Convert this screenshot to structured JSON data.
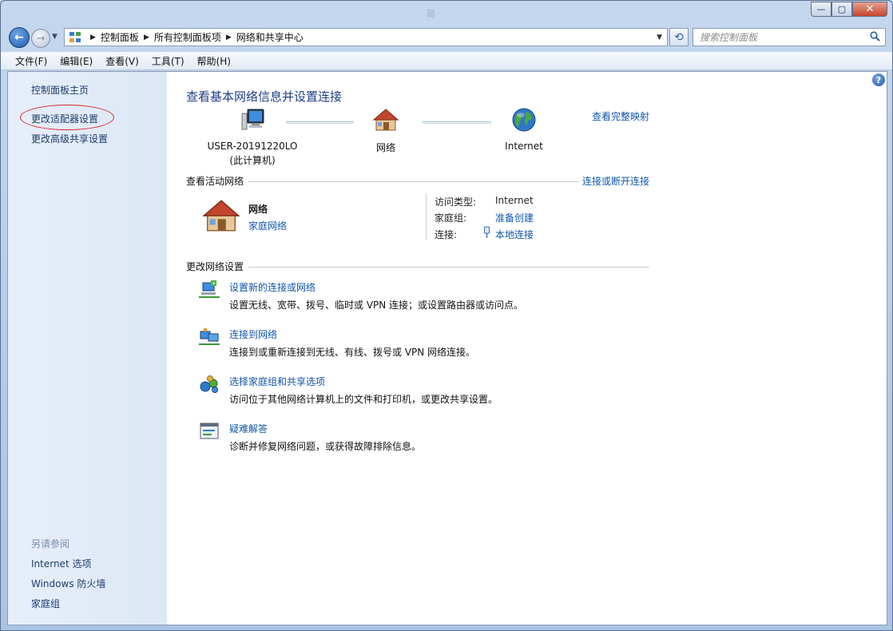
{
  "window": {
    "ghost_titles": [
      "局"
    ],
    "minimize_glyph": "—",
    "maximize_glyph": "▢",
    "close_glyph": "✕"
  },
  "nav": {
    "back_glyph": "←",
    "forward_glyph": "→",
    "history_glyph": "▼",
    "breadcrumbs": [
      "控制面板",
      "所有控制面板项",
      "网络和共享中心"
    ],
    "crumb_sep": "▶",
    "address_dropdown": "▼",
    "refresh_glyph": "⟲",
    "search_placeholder": "搜索控制面板"
  },
  "menu": [
    "文件(F)",
    "编辑(E)",
    "查看(V)",
    "工具(T)",
    "帮助(H)"
  ],
  "sidebar": {
    "links": [
      "控制面板主页",
      "更改适配器设置",
      "更改高级共享设置"
    ],
    "see_also_header": "另请参阅",
    "see_also": [
      "Internet 选项",
      "Windows 防火墙",
      "家庭组"
    ]
  },
  "help_glyph": "?",
  "main": {
    "title": "查看基本网络信息并设置连接",
    "full_map_link": "查看完整映射",
    "map_nodes": [
      {
        "label": "USER-20191220LO",
        "sublabel": "(此计算机)",
        "icon": "computer-icon"
      },
      {
        "label": "网络",
        "sublabel": "",
        "icon": "house-icon"
      },
      {
        "label": "Internet",
        "sublabel": "",
        "icon": "globe-icon"
      }
    ],
    "active_networks_header": "查看活动网络",
    "connect_disconnect_link": "连接或断开连接",
    "network": {
      "name": "网络",
      "type_link": "家庭网络",
      "access_type_label": "访问类型:",
      "access_type_value": "Internet",
      "homegroup_label": "家庭组:",
      "homegroup_link": "准备创建",
      "connection_label": "连接:",
      "connection_link": "本地连接"
    },
    "change_settings_header": "更改网络设置",
    "tasks": [
      {
        "link": "设置新的连接或网络",
        "desc": "设置无线、宽带、拨号、临时或 VPN 连接；或设置路由器或访问点。",
        "icon": "new-connection-icon"
      },
      {
        "link": "连接到网络",
        "desc": "连接到或重新连接到无线、有线、拨号或 VPN 网络连接。",
        "icon": "connect-network-icon"
      },
      {
        "link": "选择家庭组和共享选项",
        "desc": "访问位于其他网络计算机上的文件和打印机，或更改共享设置。",
        "icon": "homegroup-icon"
      },
      {
        "link": "疑难解答",
        "desc": "诊断并修复网络问题，或获得故障排除信息。",
        "icon": "troubleshoot-icon"
      }
    ]
  },
  "colors": {
    "link": "#1155aa",
    "title": "#1e3f84",
    "highlight_oval": "#d52b2b",
    "sidebar_bg": "#e3ecf8"
  }
}
